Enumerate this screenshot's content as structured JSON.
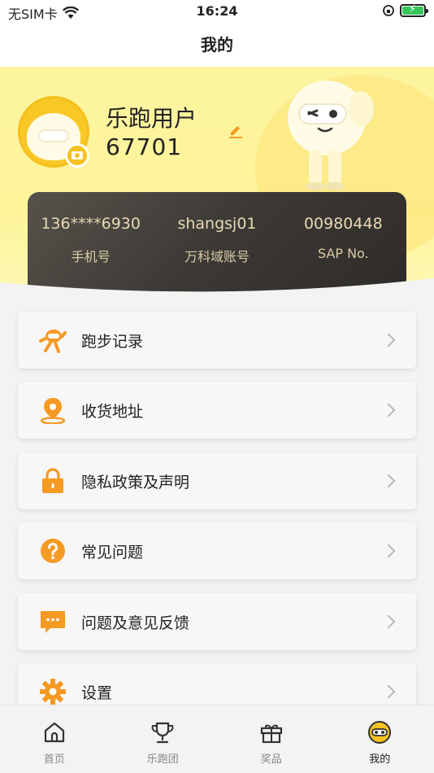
{
  "status_bar": {
    "carrier": "无SIM卡",
    "time": "16:24"
  },
  "nav": {
    "title": "我的"
  },
  "profile": {
    "name": "乐跑用户",
    "id": "67701",
    "info": [
      {
        "value": "136****6930",
        "label": "手机号"
      },
      {
        "value": "shangsj01",
        "label": "万科域账号"
      },
      {
        "value": "00980448",
        "label": "SAP No."
      }
    ]
  },
  "menu": [
    {
      "label": "跑步记录",
      "icon": "running-record-icon"
    },
    {
      "label": "收货地址",
      "icon": "location-pin-icon"
    },
    {
      "label": "隐私政策及声明",
      "icon": "lock-icon"
    },
    {
      "label": "常见问题",
      "icon": "question-icon"
    },
    {
      "label": "问题及意见反馈",
      "icon": "feedback-icon"
    },
    {
      "label": "设置",
      "icon": "gear-icon"
    }
  ],
  "tabs": [
    {
      "label": "首页",
      "icon": "home-icon"
    },
    {
      "label": "乐跑团",
      "icon": "trophy-icon"
    },
    {
      "label": "奖品",
      "icon": "gift-icon"
    },
    {
      "label": "我的",
      "icon": "mascot-face-icon",
      "active": true
    }
  ],
  "colors": {
    "accent": "#f59a23",
    "header_yellow": "#fdf4a0",
    "card_dark": "#3c3935",
    "card_text": "#e7d9b4"
  }
}
